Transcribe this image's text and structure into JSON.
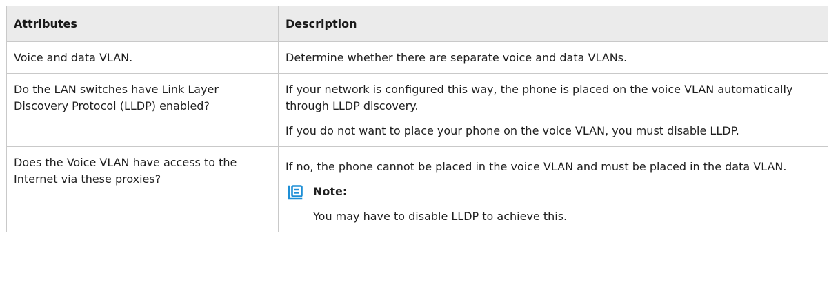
{
  "table": {
    "headers": {
      "attributes": "Attributes",
      "description": "Description"
    },
    "rows": [
      {
        "attribute": "Voice and data VLAN.",
        "description": [
          "Determine whether there are separate voice and data VLANs."
        ]
      },
      {
        "attribute": "Do the LAN switches have Link Layer Discovery Protocol (LLDP) enabled?",
        "description": [
          "If your network is configured this way, the phone is placed on the voice VLAN automatically through LLDP discovery.",
          "If you do not want to place your phone on the voice VLAN, you must disable LLDP."
        ]
      },
      {
        "attribute": "Does the Voice VLAN have access to the Internet via these proxies?",
        "description": [
          "If no, the phone cannot be placed in the voice VLAN and must be placed in the data VLAN."
        ],
        "note": {
          "icon": "note-icon",
          "title": "Note:",
          "text": "You may have to disable LLDP to achieve this."
        }
      }
    ]
  },
  "colors": {
    "header_bg": "#ebebeb",
    "border": "#c9c9c9",
    "note_icon": "#1e8fd6"
  }
}
